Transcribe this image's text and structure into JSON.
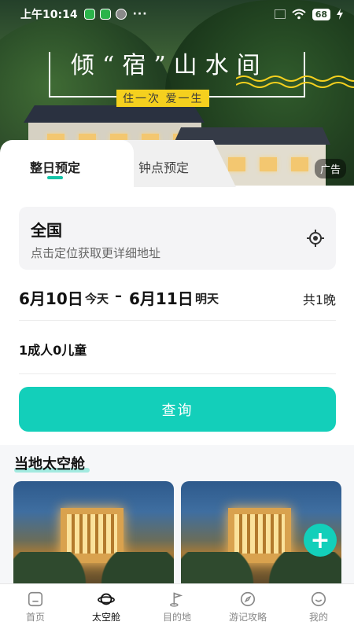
{
  "status_bar": {
    "time": "上午10:14",
    "more": "···",
    "battery": "68"
  },
  "banner": {
    "title": "倾“宿”山水间",
    "subtitle": "住一次 爱一生",
    "ad_label": "广告"
  },
  "tabs": [
    {
      "label": "整日预定",
      "active": true
    },
    {
      "label": "钟点预定",
      "active": false
    }
  ],
  "location": {
    "title": "全国",
    "hint": "点击定位获取更详细地址",
    "icon": "locate-icon"
  },
  "dates": {
    "check_in": "6月10日",
    "check_in_day": "今天",
    "separator": "–",
    "check_out": "6月11日",
    "check_out_day": "明天",
    "nights": "共1晚"
  },
  "guests": "1成人0儿童",
  "query_button": "查询",
  "section": {
    "title": "当地太空舱"
  },
  "fab_label": "+",
  "bottom_nav": [
    {
      "label": "首页",
      "icon": "home-icon",
      "active": false
    },
    {
      "label": "太空舱",
      "icon": "planet-icon",
      "active": true
    },
    {
      "label": "目的地",
      "icon": "flag-icon",
      "active": false
    },
    {
      "label": "游记攻略",
      "icon": "compass-icon",
      "active": false
    },
    {
      "label": "我的",
      "icon": "smile-icon",
      "active": false
    }
  ],
  "colors": {
    "accent": "#13cfba",
    "banner_tag": "#f5d01e"
  }
}
